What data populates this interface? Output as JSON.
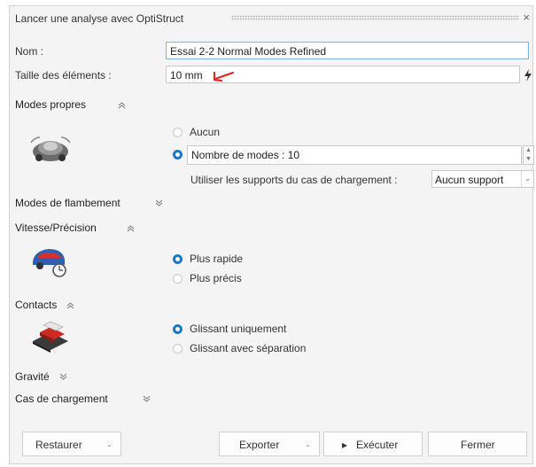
{
  "dialog": {
    "title": "Lancer une analyse avec OptiStruct",
    "close_glyph": "×"
  },
  "form": {
    "name_label": "Nom :",
    "name_value": "Essai 2-2 Normal Modes Refined",
    "size_label": "Taille des éléments :",
    "size_value": "10 mm"
  },
  "sections": {
    "modes_propres": {
      "title": "Modes propres",
      "chevron": "expanded",
      "icon": "car-modes-icon",
      "options": [
        "Aucun",
        "Nombre de modes : 10"
      ],
      "selected": "Nombre de modes : 10",
      "supports_label": "Utiliser les supports du cas de chargement :",
      "supports_value": "Aucun support"
    },
    "flambement": {
      "title": "Modes de flambement",
      "chevron": "collapsed"
    },
    "vitesse": {
      "title": "Vitesse/Précision",
      "chevron": "expanded",
      "icon": "speed-precision-icon",
      "options": [
        "Plus rapide",
        "Plus précis"
      ],
      "selected": "Plus rapide"
    },
    "contacts": {
      "title": "Contacts",
      "chevron": "expanded",
      "icon": "contacts-icon",
      "options": [
        "Glissant uniquement",
        "Glissant avec séparation"
      ],
      "selected": "Glissant uniquement"
    },
    "gravite": {
      "title": "Gravité",
      "chevron": "collapsed"
    },
    "cas_chargement": {
      "title": "Cas de chargement",
      "chevron": "collapsed"
    }
  },
  "chevrons": {
    "up": "≈",
    "down": "≈"
  },
  "buttons": {
    "restaurer": "Restaurer",
    "exporter": "Exporter",
    "executer": "Exécuter",
    "fermer": "Fermer",
    "play_glyph": "▸",
    "caret_glyph": "⌄"
  },
  "colors": {
    "accent": "#1d78c4",
    "arrow_red": "#d9302a",
    "bolt": "#333333"
  }
}
